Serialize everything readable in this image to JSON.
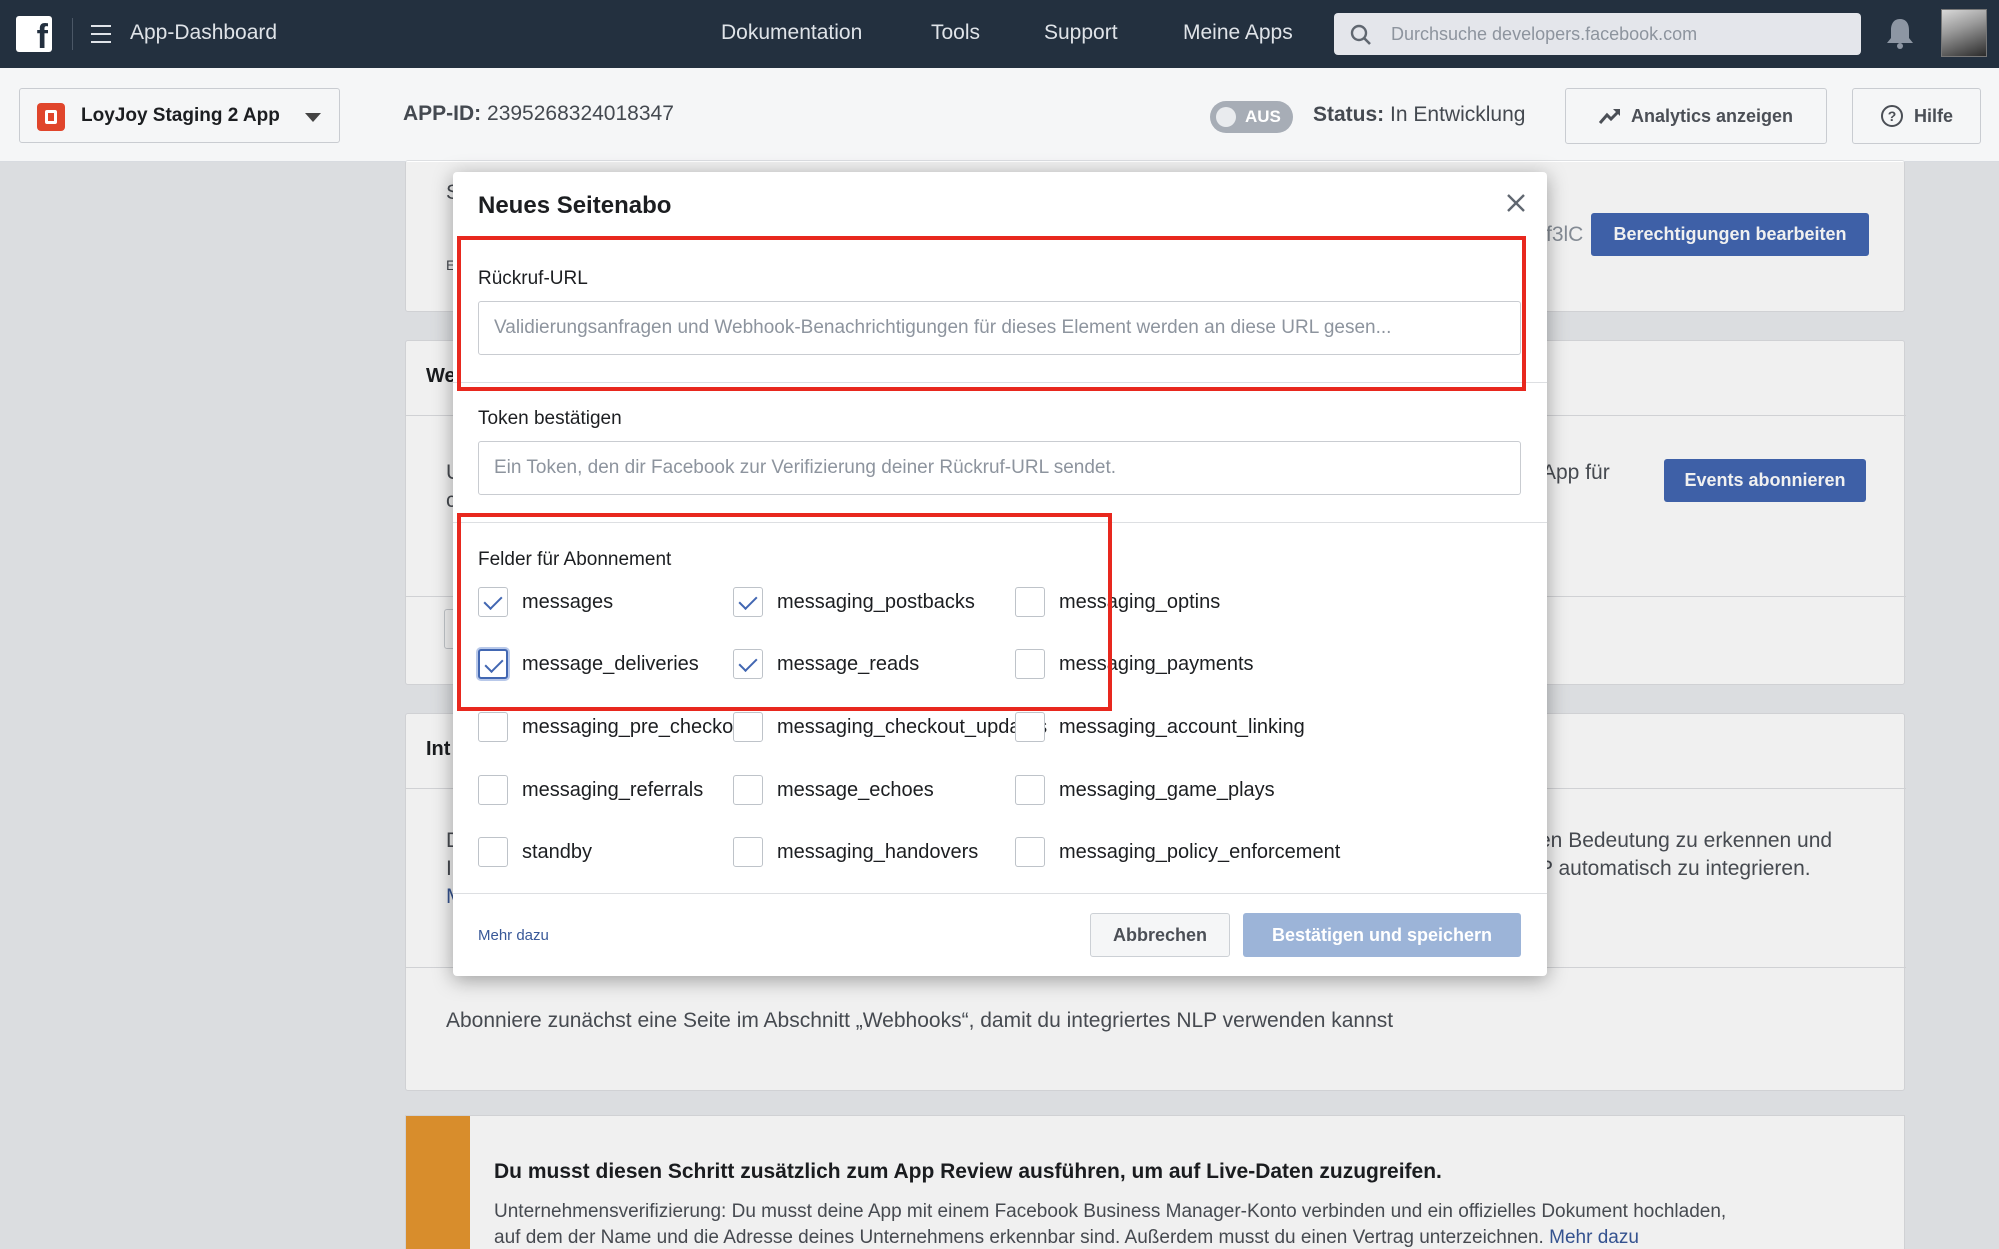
{
  "topbar": {
    "title": "App-Dashboard",
    "nav": [
      "Dokumentation",
      "Tools",
      "Support",
      "Meine Apps"
    ],
    "search_placeholder": "Durchsuche developers.facebook.com"
  },
  "appbar": {
    "app_name": "LoyJoy Staging 2 App",
    "app_id_label": "APP-ID:",
    "app_id": "2395268324018347",
    "toggle_label": "AUS",
    "status_label": "Status:",
    "status_value": "In Entwicklung",
    "analytics_label": "Analytics anzeigen",
    "help_label": "Hilfe"
  },
  "background": {
    "card1_letter": "S",
    "card1_small": "E",
    "card1_partial": "f3lC",
    "edit_permissions": "Berechtigungen bearbeiten",
    "card2_title": "We",
    "card2_text_left1": "U",
    "card2_text_left2": "c",
    "card2_text_right": "App für",
    "subscribe_events": "Events abonnieren",
    "card3_title": "Int",
    "card3_left1": "D",
    "card3_left2": "I",
    "card3_left3": "M",
    "card3_right1": "en Bedeutung zu erkennen und",
    "card3_right2": "P automatisch zu integrieren.",
    "nlp_text": "Abonniere zunächst eine Seite im Abschnitt „Webhooks“, damit du integriertes NLP verwenden kannst",
    "warn_title": "Du musst diesen Schritt zusätzlich zum App Review ausführen, um auf Live-Daten zuzugreifen.",
    "warn_text1": "Unternehmensverifizierung: Du musst deine App mit einem Facebook Business Manager-Konto verbinden und ein offizielles Dokument hochladen,",
    "warn_text2": "auf dem der Name und die Adresse deines Unternehmens erkennbar sind. Außerdem musst du einen Vertrag unterzeichnen.",
    "warn_link": "Mehr dazu"
  },
  "modal": {
    "title": "Neues Seitenabo",
    "callback_label": "Rückruf-URL",
    "callback_placeholder": "Validierungsanfragen und Webhook-Benachrichtigungen für dieses Element werden an diese URL gesen...",
    "token_label": "Token bestätigen",
    "token_placeholder": "Ein Token, den dir Facebook zur Verifizierung deiner Rückruf-URL sendet.",
    "fields_label": "Felder für Abonnement",
    "fields": [
      {
        "name": "messages",
        "checked": true
      },
      {
        "name": "messaging_postbacks",
        "checked": true
      },
      {
        "name": "messaging_optins",
        "checked": false
      },
      {
        "name": "message_deliveries",
        "checked": true
      },
      {
        "name": "message_reads",
        "checked": true
      },
      {
        "name": "messaging_payments",
        "checked": false
      },
      {
        "name": "messaging_pre_checkouts",
        "checked": false
      },
      {
        "name": "messaging_checkout_updates",
        "checked": false
      },
      {
        "name": "messaging_account_linking",
        "checked": false
      },
      {
        "name": "messaging_referrals",
        "checked": false
      },
      {
        "name": "message_echoes",
        "checked": false
      },
      {
        "name": "messaging_game_plays",
        "checked": false
      },
      {
        "name": "standby",
        "checked": false
      },
      {
        "name": "messaging_handovers",
        "checked": false
      },
      {
        "name": "messaging_policy_enforcement",
        "checked": false
      }
    ],
    "learn_more": "Mehr dazu",
    "cancel": "Abbrechen",
    "save": "Bestätigen und speichern"
  },
  "colors": {
    "topbar": "#23303f",
    "primary": "#4267b2",
    "highlight": "#e8281e"
  }
}
